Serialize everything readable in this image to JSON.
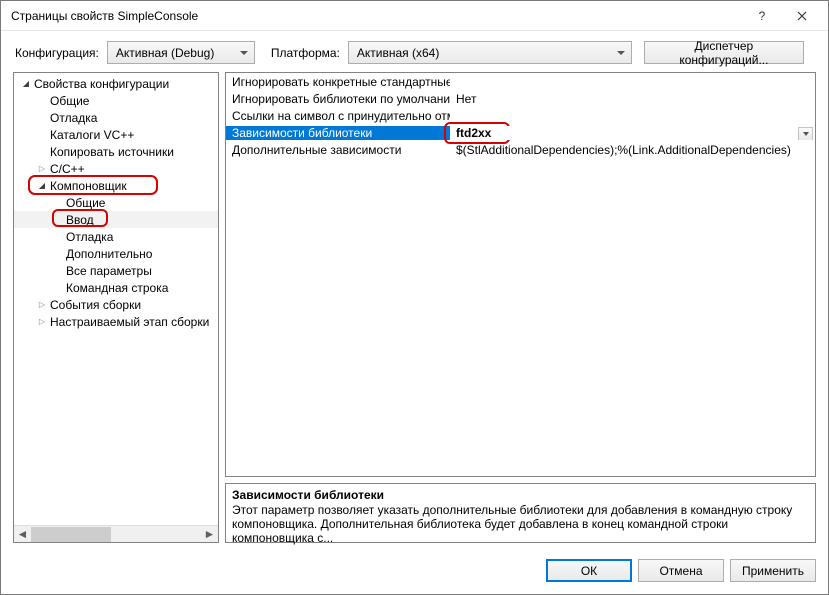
{
  "titlebar": {
    "title": "Страницы свойств SimpleConsole"
  },
  "configbar": {
    "config_label": "Конфигурация:",
    "config_value": "Активная (Debug)",
    "platform_label": "Платформа:",
    "platform_value": "Активная (x64)",
    "config_manager": "Диспетчер конфигураций..."
  },
  "tree": {
    "items": [
      {
        "label": "Свойства конфигурации",
        "depth": 0,
        "arrow": "open"
      },
      {
        "label": "Общие",
        "depth": 1,
        "arrow": "none"
      },
      {
        "label": "Отладка",
        "depth": 1,
        "arrow": "none"
      },
      {
        "label": "Каталоги VC++",
        "depth": 1,
        "arrow": "none"
      },
      {
        "label": "Копировать источники",
        "depth": 1,
        "arrow": "none"
      },
      {
        "label": "C/C++",
        "depth": 1,
        "arrow": "closed"
      },
      {
        "label": "Компоновщик",
        "depth": 1,
        "arrow": "open",
        "hl": "linker"
      },
      {
        "label": "Общие",
        "depth": 2,
        "arrow": "none"
      },
      {
        "label": "Ввод",
        "depth": 2,
        "arrow": "none",
        "selected": true,
        "hl": "input"
      },
      {
        "label": "Отладка",
        "depth": 2,
        "arrow": "none"
      },
      {
        "label": "Дополнительно",
        "depth": 2,
        "arrow": "none"
      },
      {
        "label": "Все параметры",
        "depth": 2,
        "arrow": "none"
      },
      {
        "label": "Командная строка",
        "depth": 2,
        "arrow": "none"
      },
      {
        "label": "События сборки",
        "depth": 1,
        "arrow": "closed"
      },
      {
        "label": "Настраиваемый этап сборки",
        "depth": 1,
        "arrow": "closed"
      }
    ]
  },
  "properties": {
    "rows": [
      {
        "label": "Игнорировать конкретные стандартные б",
        "value": ""
      },
      {
        "label": "Игнорировать библиотеки по умолчанию",
        "value": "Нет"
      },
      {
        "label": "Ссылки на символ с принудительно отме",
        "value": ""
      },
      {
        "label": "Зависимости библиотеки",
        "value": "ftd2xx",
        "selected": true,
        "hasDropdown": true
      },
      {
        "label": "Дополнительные зависимости",
        "value": "$(StlAdditionalDependencies);%(Link.AdditionalDependencies)"
      }
    ]
  },
  "description": {
    "title": "Зависимости библиотеки",
    "text": "Этот параметр позволяет указать дополнительные библиотеки для добавления в командную строку компоновщика. Дополнительная библиотека будет добавлена в конец командной строки компоновщика с..."
  },
  "footer": {
    "ok": "ОК",
    "cancel": "Отмена",
    "apply": "Применить"
  }
}
